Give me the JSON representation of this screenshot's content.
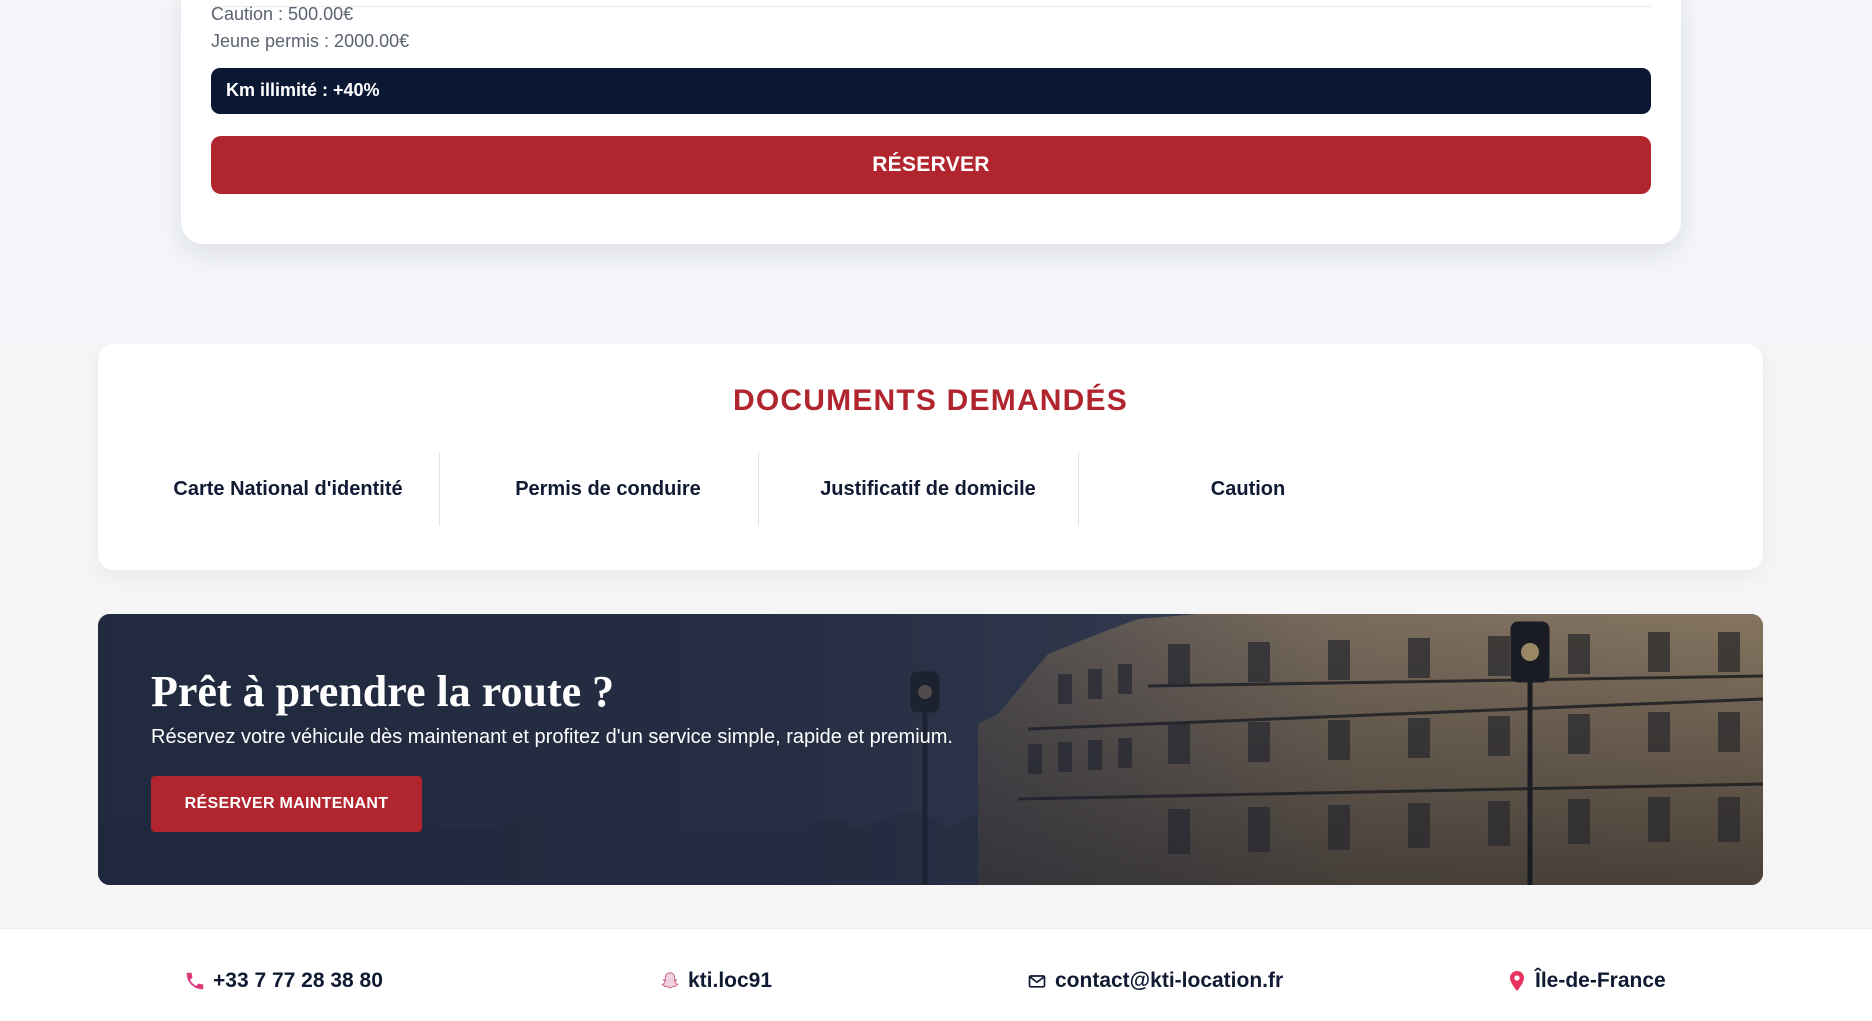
{
  "price_card": {
    "caution": "Caution : 500.00€",
    "young_license": "Jeune permis : 2000.00€",
    "km_option": "Km illimité : +40%",
    "reserve_label": "RÉSERVER"
  },
  "documents": {
    "title": "DOCUMENTS DEMANDÉS",
    "items": [
      "Carte National d'identité",
      "Permis de conduire",
      "Justificatif de domicile",
      "Caution"
    ]
  },
  "cta": {
    "title": "Prêt à prendre la route ?",
    "subtitle": "Réservez votre véhicule dès maintenant et profitez d'un service simple, rapide et premium.",
    "button_label": "RÉSERVER MAINTENANT"
  },
  "footer": {
    "phone": "+33 7 77 28 38 80",
    "social": "kti.loc91",
    "email": "contact@kti-location.fr",
    "location": "Île-de-France"
  },
  "colors": {
    "brand_red": "#b1252f",
    "navy": "#0b1833",
    "text_dark": "#101a33"
  },
  "icons": [
    "phone-icon",
    "snapchat-icon",
    "mail-icon",
    "location-pin-icon"
  ]
}
